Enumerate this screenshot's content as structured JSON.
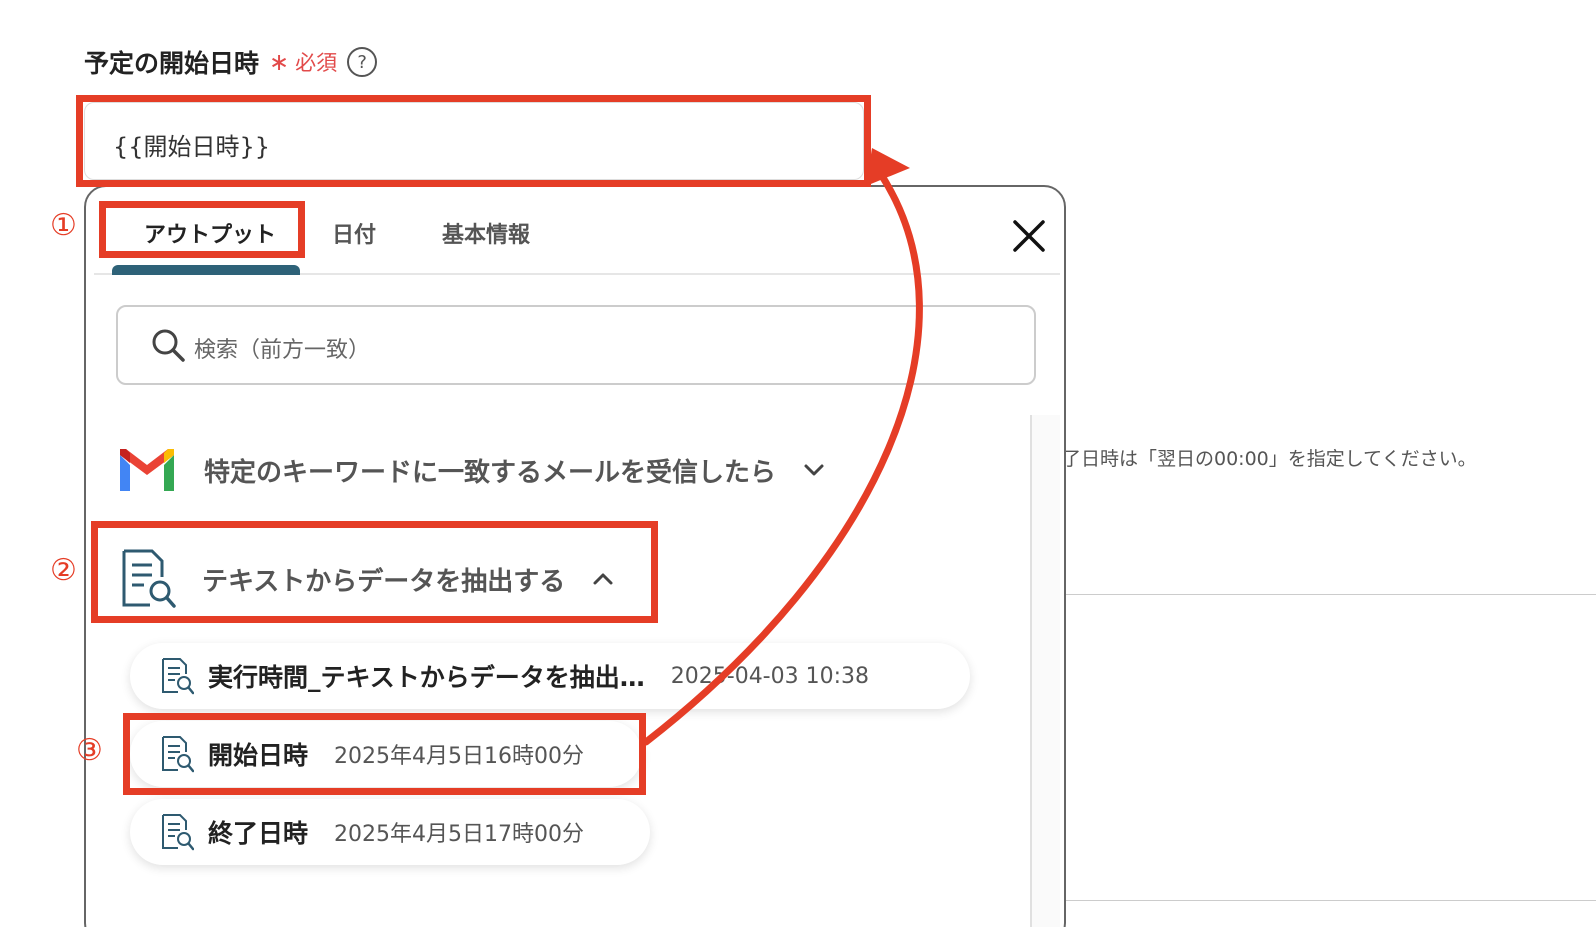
{
  "field": {
    "label": "予定の開始日時",
    "required_star": "∗",
    "required_text": "必須",
    "help_icon": "?",
    "value": "{{開始日時}}"
  },
  "background": {
    "hint_text": "了日時は「翌日の00:00」を指定してください。"
  },
  "popup": {
    "tabs": [
      "アウトプット",
      "日付",
      "基本情報"
    ],
    "active_tab": "アウトプット",
    "search_placeholder": "検索（前方一致）",
    "groups": [
      {
        "title": "特定のキーワードに一致するメールを受信したら",
        "icon": "gmail-icon",
        "expanded": false
      },
      {
        "title": "テキストからデータを抽出する",
        "icon": "document-search-icon",
        "expanded": true
      }
    ],
    "items": [
      {
        "name": "実行時間_テキストからデータを抽出…",
        "value": "2025-04-03 10:38"
      },
      {
        "name": "開始日時",
        "value": "2025年4月5日16時00分"
      },
      {
        "name": "終了日時",
        "value": "2025年4月5日17時00分"
      }
    ]
  },
  "annotations": {
    "step1": "①",
    "step2": "②",
    "step3": "③",
    "color": "#e53d26"
  },
  "colors": {
    "accent": "#2e6278",
    "required": "#e24a4a",
    "highlight": "#e53d26"
  }
}
